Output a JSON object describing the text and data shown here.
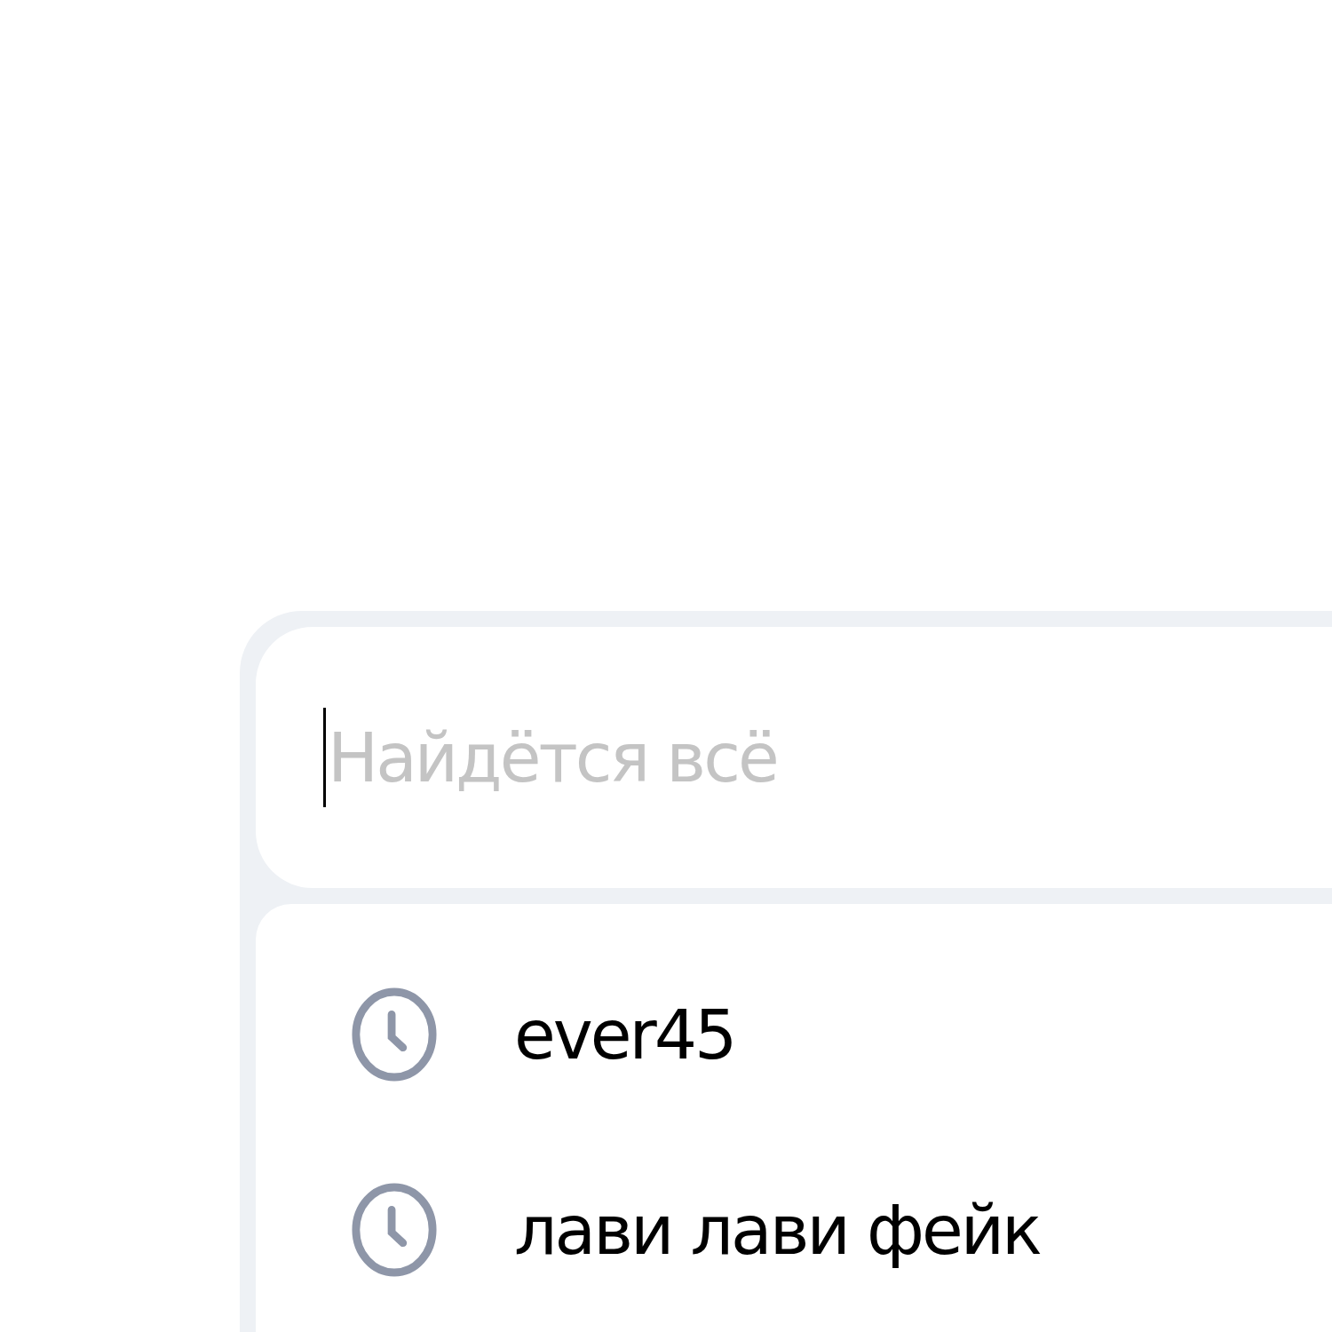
{
  "search": {
    "placeholder": "Найдётся всё"
  },
  "suggestions": [
    {
      "kind": "history",
      "text": "ever45"
    },
    {
      "kind": "history",
      "text": "лави лави фейк"
    }
  ]
}
